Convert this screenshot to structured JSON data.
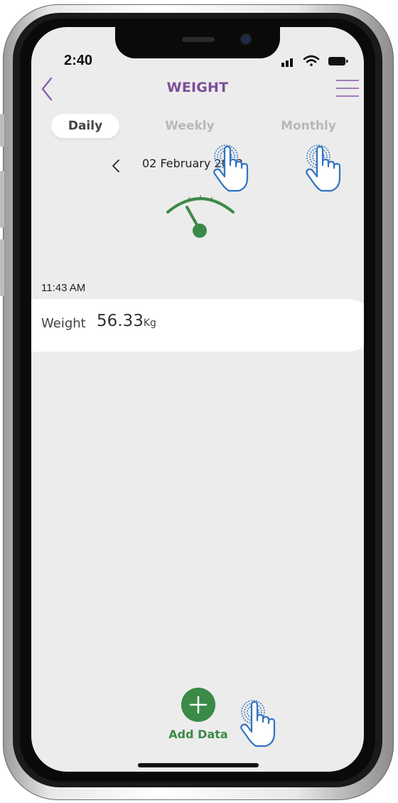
{
  "status_bar": {
    "time": "2:40"
  },
  "header": {
    "title": "WEIGHT"
  },
  "tabs": [
    {
      "label": "Daily",
      "selected": true
    },
    {
      "label": "Weekly",
      "selected": false
    },
    {
      "label": "Monthly",
      "selected": false
    }
  ],
  "date_nav": {
    "date": "02 February 2022"
  },
  "record": {
    "time": "11:43 AM",
    "label": "Weight",
    "value": "56.33",
    "unit": "Kg"
  },
  "add": {
    "label": "Add Data"
  },
  "colors": {
    "title_purple": "#7b4f98",
    "accent_green": "#3b8a48",
    "hint_blue": "#2f73c2",
    "screen_bg": "#ececec"
  },
  "icons": [
    "back-icon",
    "menu-icon",
    "signal-icon",
    "wifi-icon",
    "battery-icon",
    "chevron-left-icon",
    "gauge-icon",
    "plus-icon",
    "tap-hand-icon"
  ]
}
